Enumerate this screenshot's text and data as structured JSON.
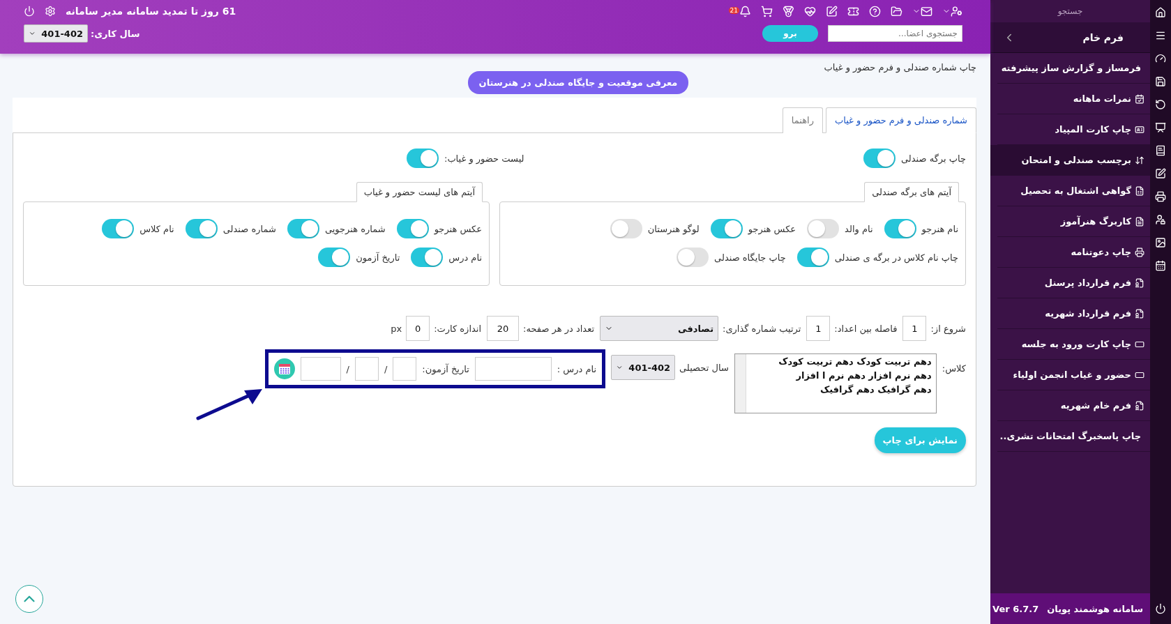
{
  "header": {
    "notice": "61 روز تا تمدید سامانه مدیر سامانه",
    "bell_badge": "21",
    "search": {
      "placeholder": "جستجوی اعضا..."
    },
    "go_button": "برو",
    "year_label": "سال کاری:",
    "year_value": "401-402"
  },
  "page_title": "چاپ شماره صندلی و فرم حضور و غیاب",
  "intro_button": "معرفی موقعیت و جایگاه صندلی در هنرستان",
  "tabs": [
    {
      "label": "شماره صندلی و فرم حضور و غیاب",
      "selected": true
    },
    {
      "label": "راهنما",
      "selected": false
    }
  ],
  "main_toggles": [
    {
      "label": "چاپ برگه صندلی",
      "on": true
    },
    {
      "label": "لیست حضور و غیاب:",
      "on": true
    }
  ],
  "groups": [
    {
      "legend": "آیتم های برگه صندلی",
      "lines": [
        {
          "toggles": [
            {
              "label": "نام هنرجو",
              "on": true
            },
            {
              "label": "نام والد",
              "on": false
            },
            {
              "label": "عکس هنرجو",
              "on": true
            },
            {
              "label": "لوگو هنرستان",
              "on": false
            }
          ]
        },
        {
          "toggles": [
            {
              "label": "چاپ نام کلاس در برگه ی صندلی",
              "on": true
            },
            {
              "label": "چاپ جایگاه صندلی",
              "on": false
            }
          ]
        }
      ]
    },
    {
      "legend": "آیتم های لیست حضور و غیاب",
      "lines": [
        {
          "toggles": [
            {
              "label": "عکس هنرجو",
              "on": true
            },
            {
              "label": "شماره هنرجویی",
              "on": true
            },
            {
              "label": "شماره صندلی",
              "on": true
            },
            {
              "label": "نام کلاس",
              "on": true
            }
          ]
        },
        {
          "toggles": [
            {
              "label": "نام درس",
              "on": true
            },
            {
              "label": "تاریخ آزمون",
              "on": true
            }
          ]
        }
      ]
    }
  ],
  "settings": [
    {
      "kind": "input",
      "label": "شروع از:",
      "value": "1"
    },
    {
      "kind": "input",
      "label": "فاصله بین اعداد:",
      "value": "1"
    },
    {
      "kind": "select",
      "label": "ترتیب شماره گذاری:",
      "value": "تصادفی"
    },
    {
      "kind": "input",
      "label": "تعداد در هر صفحه:",
      "value": "20"
    },
    {
      "kind": "input",
      "label": "اندازه کارت:",
      "value": "0",
      "unit": "px"
    }
  ],
  "class_label": "کلاس:",
  "classes": [
    "دهم تربیت کودک دهم تربیت کودک",
    "دهم نرم افزار دهم نرم ا افزار",
    "دهم گرافیک دهم گرافیک"
  ],
  "school_year": {
    "label": "سال تحصیلی",
    "value": "401-402"
  },
  "course_label": "نام درس :",
  "exam_date": {
    "label": "تاریخ آزمون:",
    "separators": [
      "/",
      "/"
    ]
  },
  "show_button": "نمایش برای چاپ",
  "sidebar": {
    "search": {
      "placeholder": "جستجو"
    },
    "section": "فرم خام",
    "items": [
      {
        "label": "فرمساز و گزارش ساز پیشرفته",
        "selected": false
      },
      {
        "label": "نمرات ماهانه",
        "selected": false
      },
      {
        "label": "چاپ کارت المپیاد",
        "selected": false
      },
      {
        "label": "برچسب صندلی و امتحان",
        "selected": true
      },
      {
        "label": "گواهی اشتغال به تحصیل",
        "selected": false
      },
      {
        "label": "کاربرگ هنرآموز",
        "selected": false
      },
      {
        "label": "چاپ دعوتنامه",
        "selected": false
      },
      {
        "label": "فرم قرارداد پرسنل",
        "selected": false
      },
      {
        "label": "فرم قرارداد شهریه",
        "selected": false
      },
      {
        "label": "چاپ کارت ورود به جلسه",
        "selected": false
      },
      {
        "label": "حضور و غیاب انجمن اولیاء",
        "selected": false
      },
      {
        "label": "فرم خام شهریه",
        "selected": false
      },
      {
        "label": "چاپ پاسخبرگ امتحانات تشری..",
        "selected": false
      }
    ],
    "footer_name": "سامانه هوشمند پویان",
    "version": "Ver 6.7.7"
  }
}
